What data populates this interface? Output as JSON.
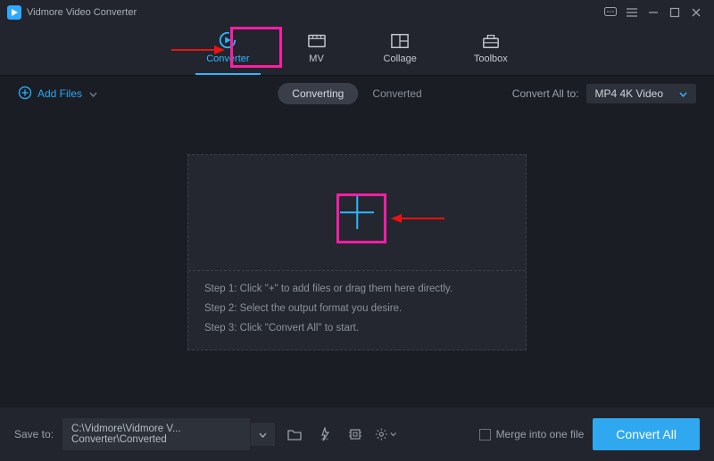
{
  "app": {
    "title": "Vidmore Video Converter"
  },
  "nav": {
    "converter": "Converter",
    "mv": "MV",
    "collage": "Collage",
    "toolbox": "Toolbox"
  },
  "toolbar": {
    "add_files": "Add Files",
    "tab_converting": "Converting",
    "tab_converted": "Converted",
    "convert_all_to_label": "Convert All to:",
    "format_selected": "MP4 4K Video"
  },
  "dropzone": {
    "step1": "Step 1: Click \"+\" to add files or drag them here directly.",
    "step2": "Step 2: Select the output format you desire.",
    "step3": "Step 3: Click \"Convert All\" to start."
  },
  "bottom": {
    "save_to_label": "Save to:",
    "save_path": "C:\\Vidmore\\Vidmore V... Converter\\Converted",
    "merge_label": "Merge into one file",
    "convert_button": "Convert All"
  }
}
